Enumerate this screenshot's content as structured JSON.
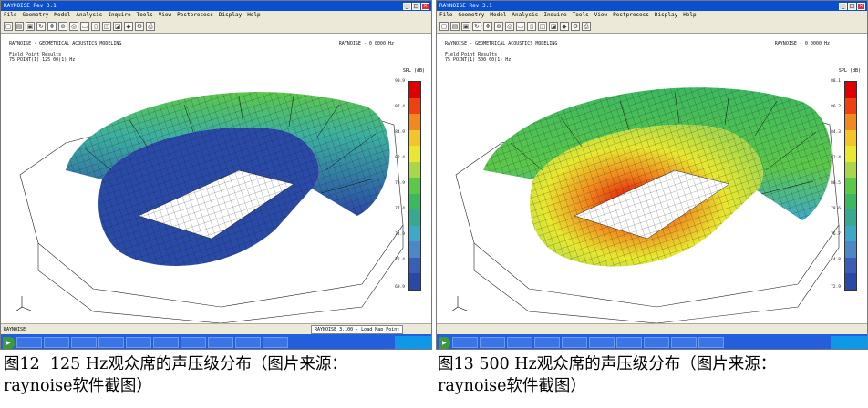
{
  "screens": [
    {
      "window_title": "RAYNOISE Rev 3.1",
      "menu": [
        "File",
        "Geometry",
        "Model",
        "Analysis",
        "Inquire",
        "Tools",
        "View",
        "Postprocess",
        "Display",
        "Help"
      ],
      "header_lines": [
        "RAYNOISE - GEOMETRICAL ACOUSTICS MODELING",
        "Field Point Results",
        "75 POINT(1) 125 00(1) Hz"
      ],
      "header_right": "RAYNOISE - 0 0000 Hz",
      "scale_title": "SPL (dB)",
      "scale_colors": [
        "#e00000",
        "#f04010",
        "#f08a1e",
        "#f2c62a",
        "#e8e830",
        "#a8d84a",
        "#5cc84a",
        "#3cb860",
        "#38a890",
        "#3fa8c8",
        "#4c88c8",
        "#3a5eb8",
        "#2a48a8"
      ],
      "scale_ticks": [
        "90.9",
        "87.4",
        "84.9",
        "82.4",
        "79.9",
        "77.4",
        "74.9",
        "72.4",
        "69.9"
      ],
      "status_left": "RAYNOISE",
      "status_box": "RAYNOISE 3.100 - Load Map Point",
      "task_items": [
        "",
        "",
        "",
        "",
        "",
        "",
        "",
        "",
        "",
        "",
        "",
        "",
        "",
        ""
      ]
    },
    {
      "window_title": "RAYNOISE Rev 3.1",
      "menu": [
        "File",
        "Geometry",
        "Model",
        "Analysis",
        "Inquire",
        "Tools",
        "View",
        "Postprocess",
        "Display",
        "Help"
      ],
      "header_lines": [
        "RAYNOISE - GEOMETRICAL ACOUSTICS MODELING",
        "Field Point Results",
        "75 POINT(1) 500 00(1) Hz"
      ],
      "header_right": "RAYNOISE - 0 0000 Hz",
      "scale_title": "SPL (dB)",
      "scale_colors": [
        "#e00000",
        "#f04010",
        "#f08a1e",
        "#f2c62a",
        "#e8e830",
        "#a8d84a",
        "#5cc84a",
        "#3cb860",
        "#38a890",
        "#3fa8c8",
        "#4c88c8",
        "#3a5eb8",
        "#2a48a8"
      ],
      "scale_ticks": [
        "88.1",
        "86.2",
        "84.3",
        "82.4",
        "80.5",
        "78.6",
        "76.7",
        "74.8",
        "72.9"
      ],
      "status_left": "",
      "status_box": "",
      "task_items": [
        "",
        "",
        "",
        "",
        "",
        "",
        "",
        "",
        "",
        "",
        "",
        "",
        "",
        ""
      ]
    }
  ],
  "captions": [
    "图12  125 Hz观众席的声压级分布（图片来源：\nraynoise软件截图）",
    "图13 500 Hz观众席的声压级分布（图片来源：\nraynoise软件截图）"
  ]
}
